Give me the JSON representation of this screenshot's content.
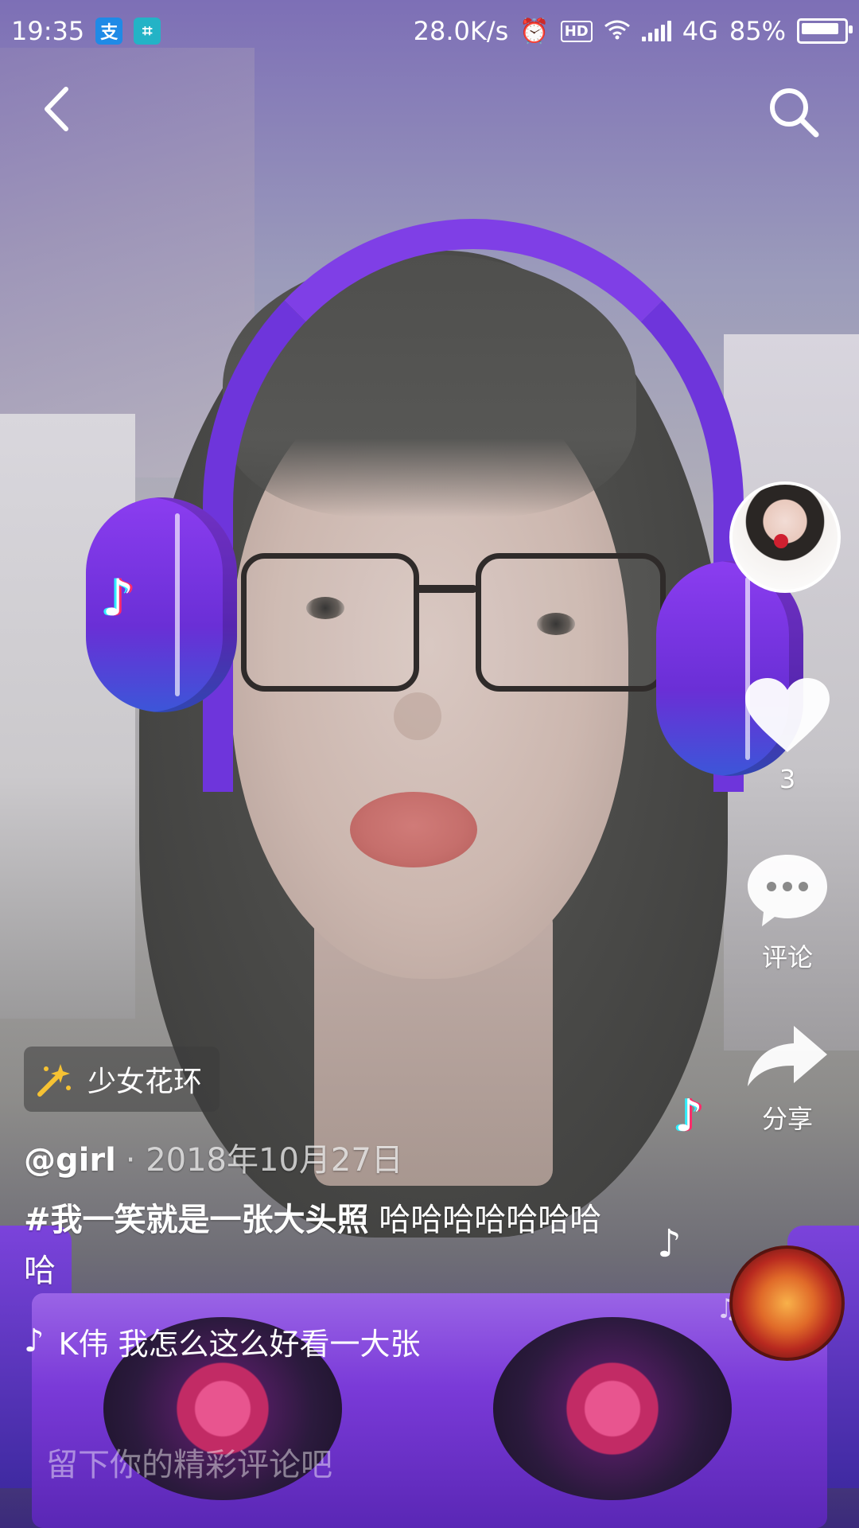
{
  "status_bar": {
    "time": "19:35",
    "app_icons": [
      "alipay-icon",
      "scan-icon"
    ],
    "net_speed": "28.0K/s",
    "hd_label": "HD",
    "network": "4G",
    "battery": "85%",
    "battery_level": 0.85
  },
  "top_bar": {
    "back_icon": "chevron-left-icon",
    "search_icon": "search-icon"
  },
  "effect": {
    "icon": "magic-wand-icon",
    "label": "少女花环"
  },
  "post": {
    "author": "@girl",
    "date": " · 2018年10月27日",
    "hashtag": "#我一笑就是一张大头照",
    "text": " 哈哈哈哈哈哈哈哈"
  },
  "music": {
    "icon": "music-note-icon",
    "text": "K伟   我怎么这么好看一大张"
  },
  "actions": {
    "like_count": "3",
    "comment_label": "评论",
    "share_label": "分享"
  },
  "comment_box": {
    "placeholder": "留下你的精彩评论吧"
  },
  "colors": {
    "accent_purple": "#7f3fe6",
    "deck_pink": "#e8558f"
  }
}
